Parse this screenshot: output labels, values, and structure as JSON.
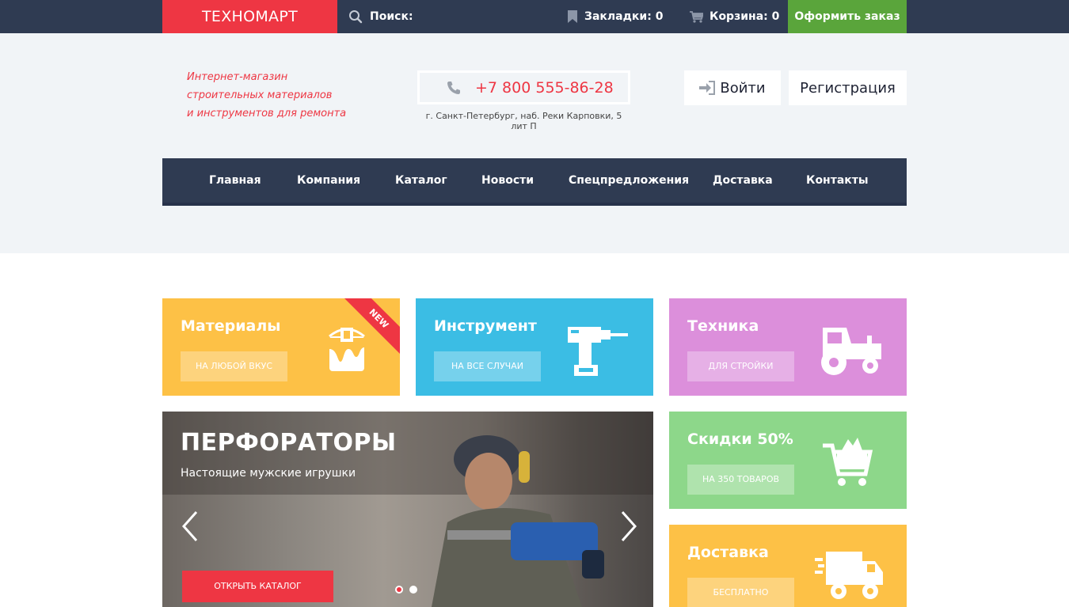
{
  "topbar": {
    "logo": "ТЕХНОМАРТ",
    "search_label": "Поиск:",
    "bookmarks_label": "Закладки: 0",
    "cart_label": "Корзина: 0",
    "order_button": "Оформить заказ"
  },
  "header": {
    "tagline": [
      "Интернет-магазин",
      "строительных материалов",
      "и инструментов для ремонта"
    ],
    "phone": "+7 800 555-86-28",
    "address": "г. Санкт-Петербург, наб. Реки Карповки, 5 лит П",
    "login_button": "Войти",
    "register_button": "Регистрация"
  },
  "nav": {
    "items": [
      "Главная",
      "Компания",
      "Каталог",
      "Новости",
      "Спецпредложения",
      "Доставка",
      "Контакты"
    ]
  },
  "tiles": [
    {
      "title": "Материалы",
      "button": "НА ЛЮБОЙ ВКУС",
      "badge": "NEW",
      "icon": "paint-bucket-icon",
      "color": "#fdc146"
    },
    {
      "title": "Инструмент",
      "button": "НА ВСЕ СЛУЧАИ",
      "icon": "drill-icon",
      "color": "#3bbde4"
    },
    {
      "title": "Техника",
      "button": "ДЛЯ СТРОЙКИ",
      "icon": "tractor-icon",
      "color": "#dc8fdb"
    },
    {
      "title": "Скидки 50%",
      "button": "НА 350 ТОВАРОВ",
      "icon": "shopping-cart-icon",
      "color": "#8dd78a"
    },
    {
      "title": "Доставка",
      "button": "БЕСПЛАТНО",
      "icon": "delivery-truck-icon",
      "color": "#fdc146"
    }
  ],
  "slider": {
    "title": "ПЕРФОРАТОРЫ",
    "subtitle": "Настоящие мужские игрушки",
    "button": "ОТКРЫТЬ КАТАЛОГ",
    "slide_count": 2,
    "active_slide": 1
  },
  "colors": {
    "accent": "#ee3643",
    "dark": "#2f3b52",
    "green": "#5aa53b",
    "light_bg": "#f1f4f7"
  }
}
